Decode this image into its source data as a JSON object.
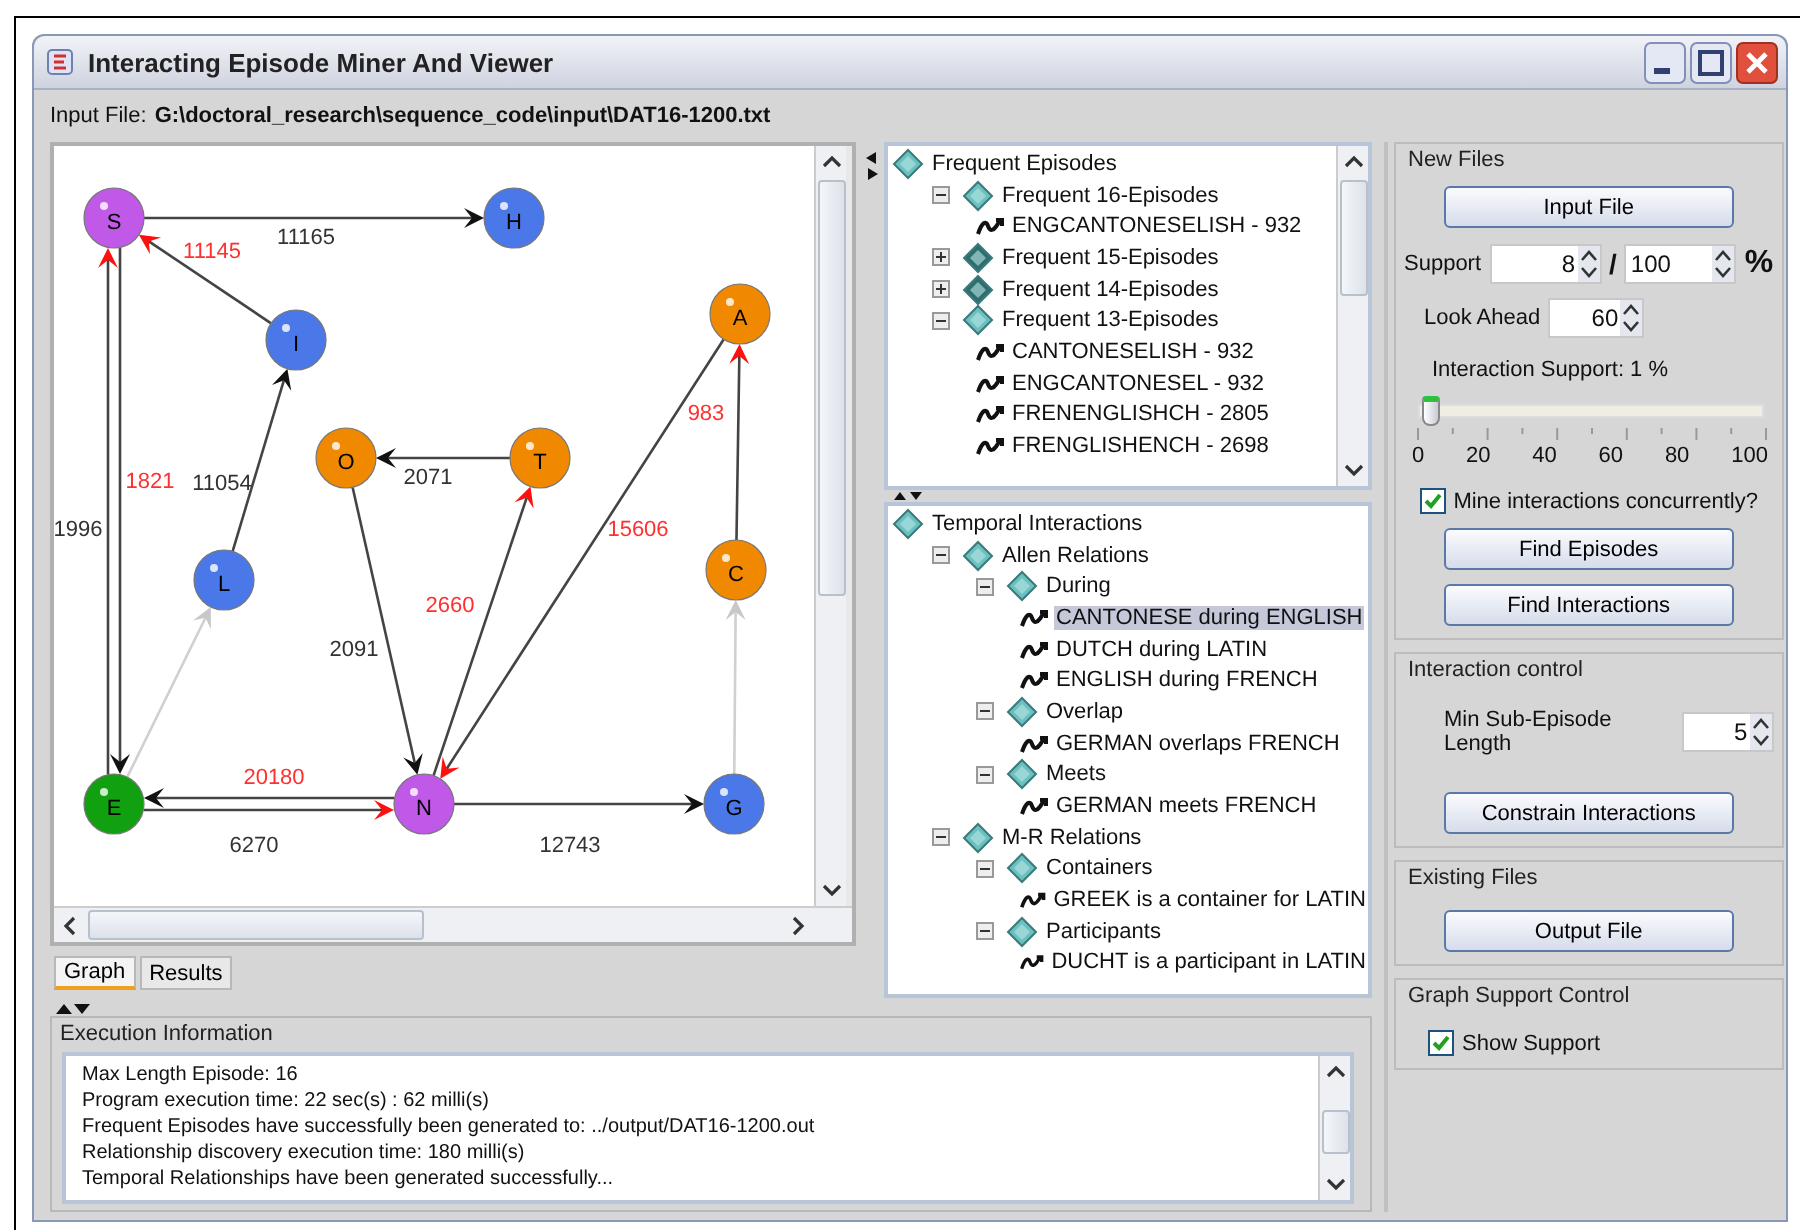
{
  "window": {
    "title": "Interacting Episode Miner And Viewer"
  },
  "input_file": {
    "label": "Input File:",
    "path": "G:\\doctoral_research\\sequence_code\\input\\DAT16-1200.txt"
  },
  "graph": {
    "nodes": [
      {
        "label": "S",
        "color": "#c058e8"
      },
      {
        "label": "H",
        "color": "#4a78e8"
      },
      {
        "label": "I",
        "color": "#4a78e8"
      },
      {
        "label": "A",
        "color": "#f08800"
      },
      {
        "label": "O",
        "color": "#f08800"
      },
      {
        "label": "T",
        "color": "#f08800"
      },
      {
        "label": "C",
        "color": "#f08800"
      },
      {
        "label": "L",
        "color": "#4a78e8"
      },
      {
        "label": "E",
        "color": "#10a010"
      },
      {
        "label": "N",
        "color": "#c058e8"
      },
      {
        "label": "G",
        "color": "#4a78e8"
      }
    ],
    "edges": [
      {
        "kind": "normal",
        "label": "11165",
        "highlighted": false
      },
      {
        "kind": "normal",
        "label": "11145",
        "highlighted": true
      },
      {
        "kind": "normal",
        "label": "1996",
        "highlighted": false
      },
      {
        "kind": "normal",
        "label": "1821",
        "highlighted": true
      },
      {
        "kind": "normal",
        "label": "11054",
        "highlighted": false
      },
      {
        "kind": "normal",
        "label": "2071",
        "highlighted": false
      },
      {
        "kind": "normal",
        "label": "2091",
        "highlighted": false
      },
      {
        "kind": "normal",
        "label": "2660",
        "highlighted": true
      },
      {
        "kind": "normal",
        "label": "15606",
        "highlighted": true
      },
      {
        "kind": "normal",
        "label": "983",
        "highlighted": true
      },
      {
        "kind": "faint",
        "highlighted": false
      },
      {
        "kind": "faint",
        "highlighted": false
      },
      {
        "kind": "normal",
        "label": "6270",
        "highlighted": false
      },
      {
        "kind": "normal",
        "label": "20180",
        "highlighted": true
      },
      {
        "kind": "normal",
        "label": "12743",
        "highlighted": false
      }
    ]
  },
  "view_tabs": [
    {
      "label": "Graph",
      "selected": true
    },
    {
      "label": "Results",
      "selected": false
    }
  ],
  "episodes_tree": {
    "label": "Frequent Episodes",
    "children": [
      {
        "label": "Frequent 16-Episodes",
        "expanded": true,
        "children": [
          {
            "label": "ENGCANTONESELISH - 932",
            "selected": false
          }
        ]
      },
      {
        "label": "Frequent 15-Episodes",
        "expanded": false
      },
      {
        "label": "Frequent 14-Episodes",
        "expanded": false
      },
      {
        "label": "Frequent 13-Episodes",
        "expanded": true,
        "children": [
          {
            "label": "CANTONESELISH - 932",
            "selected": false
          },
          {
            "label": "ENGCANTONESEL - 932",
            "selected": false
          },
          {
            "label": "FRENENGLISHCH - 2805",
            "selected": false
          },
          {
            "label": "FRENGLISHENCH - 2698",
            "selected": false
          }
        ]
      }
    ]
  },
  "interactions_tree": {
    "label": "Temporal Interactions",
    "children": [
      {
        "label": "Allen Relations",
        "expanded": true,
        "children": [
          {
            "label": "During",
            "expanded": true,
            "children": [
              {
                "label": "CANTONESE during ENGLISH",
                "selected": true
              },
              {
                "label": "DUTCH during LATIN",
                "selected": false
              },
              {
                "label": "ENGLISH during FRENCH",
                "selected": false
              }
            ]
          },
          {
            "label": "Overlap",
            "expanded": true,
            "children": [
              {
                "label": "GERMAN overlaps FRENCH",
                "selected": false
              }
            ]
          },
          {
            "label": "Meets",
            "expanded": true,
            "children": [
              {
                "label": "GERMAN meets FRENCH",
                "selected": false
              }
            ]
          }
        ]
      },
      {
        "label": "M-R Relations",
        "expanded": true,
        "children": [
          {
            "label": "Containers",
            "expanded": true,
            "children": [
              {
                "label": "GREEK is a container for LATIN",
                "selected": false
              }
            ]
          },
          {
            "label": "Participants",
            "expanded": true,
            "children": [
              {
                "label": "DUCHT is a participant in LATIN",
                "selected": false
              }
            ]
          }
        ]
      }
    ]
  },
  "new_files": {
    "title": "New Files",
    "input_button": "Input File",
    "support": {
      "label": "Support",
      "value": "8",
      "separator": "/",
      "total": "100",
      "unit": "%"
    },
    "look_ahead": {
      "label": "Look Ahead",
      "value": "60"
    },
    "interaction_support": {
      "label": "Interaction Support: 1 %",
      "level": 0.01,
      "ticks": [
        "0",
        "20",
        "40",
        "60",
        "80",
        "100"
      ]
    },
    "concurrent": {
      "label": "Mine interactions concurrently?",
      "checked": true
    },
    "buttons": [
      "Find Episodes",
      "Find Interactions"
    ]
  },
  "interaction_control": {
    "title": "Interaction control",
    "min_length": {
      "label": "Min Sub-Episode Length",
      "value": "5"
    },
    "button": "Constrain Interactions"
  },
  "existing_files": {
    "title": "Existing Files",
    "button": "Output File"
  },
  "graph_support": {
    "title": "Graph Support Control",
    "show_support": {
      "label": "Show Support",
      "checked": true
    }
  },
  "execution_info": {
    "title": "Execution Information",
    "lines": [
      "Max Length Episode: 16",
      "Program execution time: 22 sec(s) : 62 milli(s)",
      "Frequent Episodes have successfully been generated to: ../output/DAT16-1200.out",
      "Relationship discovery execution time: 180 milli(s)",
      "Temporal Relationships have been generated successfully..."
    ]
  }
}
